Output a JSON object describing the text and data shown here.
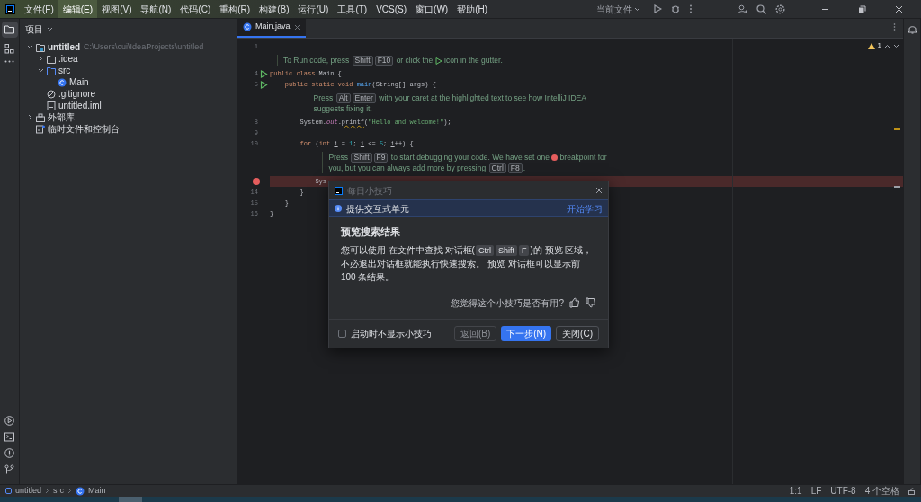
{
  "menu": [
    {
      "label": "文件(F)",
      "selected": false
    },
    {
      "label": "编辑(E)",
      "selected": true
    },
    {
      "label": "视图(V)",
      "selected": false
    },
    {
      "label": "导航(N)",
      "selected": false
    },
    {
      "label": "代码(C)",
      "selected": false
    },
    {
      "label": "重构(R)",
      "selected": false
    },
    {
      "label": "构建(B)",
      "selected": false
    },
    {
      "label": "运行(U)",
      "selected": false
    },
    {
      "label": "工具(T)",
      "selected": false
    },
    {
      "label": "VCS(S)",
      "selected": false
    },
    {
      "label": "窗口(W)",
      "selected": false
    },
    {
      "label": "帮助(H)",
      "selected": false
    }
  ],
  "run_config": "当前文件",
  "project_panel": {
    "title": "项目",
    "tree": [
      {
        "kind": "module",
        "label": "untitled",
        "path": "C:\\Users\\cui\\IdeaProjects\\untitled",
        "expanded": true,
        "children": [
          {
            "kind": "folder",
            "label": ".idea",
            "expanded": false
          },
          {
            "kind": "source",
            "label": "src",
            "expanded": true,
            "children": [
              {
                "kind": "class",
                "label": "Main"
              }
            ]
          },
          {
            "kind": "ignore",
            "label": ".gitignore"
          },
          {
            "kind": "file",
            "label": "untitled.iml"
          }
        ]
      },
      {
        "kind": "library",
        "label": "外部库",
        "expanded": false
      },
      {
        "kind": "scratch",
        "label": "临时文件和控制台"
      }
    ]
  },
  "editor": {
    "tab": {
      "label": "Main.java",
      "selected": true
    },
    "warnings": "1",
    "lines": [
      {
        "kind": "code",
        "number": "1"
      },
      {
        "kind": "hint",
        "parts": [
          {
            "kind": "text",
            "text": "To Run code, press "
          },
          {
            "kind": "key",
            "text": "Shift"
          },
          {
            "kind": "key",
            "text": "F10"
          },
          {
            "kind": "text",
            "text": " or click the "
          },
          {
            "kind": "run-icon"
          },
          {
            "kind": "text",
            "text": " icon in the gutter."
          }
        ]
      },
      {
        "kind": "code",
        "number": "4",
        "run": true,
        "tokens": [
          {
            "kind": "keyword",
            "text": "public class "
          },
          {
            "kind": "plain",
            "text": "Main {"
          }
        ]
      },
      {
        "kind": "code",
        "number": "5",
        "run": true,
        "tokens": [
          {
            "kind": "keyword",
            "text": "    public static void "
          },
          {
            "kind": "method",
            "text": "main"
          },
          {
            "kind": "plain",
            "text": "(String[] args) {"
          }
        ]
      },
      {
        "kind": "hint",
        "parts": [
          {
            "kind": "text",
            "text": "Press "
          },
          {
            "kind": "key",
            "text": "Alt"
          },
          {
            "kind": "key",
            "text": "Enter"
          },
          {
            "kind": "text",
            "text": " with your caret at the highlighted text to see how IntelliJ IDEA suggests fixing it."
          }
        ]
      },
      {
        "kind": "code",
        "number": "8",
        "tokens": [
          {
            "kind": "plain",
            "text": "        System."
          },
          {
            "kind": "field",
            "text": "out"
          },
          {
            "kind": "plain",
            "text": "."
          },
          {
            "kind": "warning",
            "text": "printf"
          },
          {
            "kind": "plain",
            "text": "("
          },
          {
            "kind": "string",
            "text": "\"Hello and welcome!\""
          },
          {
            "kind": "plain",
            "text": ");"
          }
        ]
      },
      {
        "kind": "code",
        "number": "9"
      },
      {
        "kind": "code",
        "number": "10",
        "tokens": [
          {
            "kind": "keyword",
            "text": "        for "
          },
          {
            "kind": "plain",
            "text": "("
          },
          {
            "kind": "keyword",
            "text": "int "
          },
          {
            "kind": "variable",
            "text": "i"
          },
          {
            "kind": "plain",
            "text": " = "
          },
          {
            "kind": "number",
            "text": "1"
          },
          {
            "kind": "plain",
            "text": "; "
          },
          {
            "kind": "variable",
            "text": "i"
          },
          {
            "kind": "plain",
            "text": " <= "
          },
          {
            "kind": "number",
            "text": "5"
          },
          {
            "kind": "plain",
            "text": "; "
          },
          {
            "kind": "variable",
            "text": "i"
          },
          {
            "kind": "plain",
            "text": "++) {"
          }
        ]
      },
      {
        "kind": "hint",
        "parts": [
          {
            "kind": "text",
            "text": "Press "
          },
          {
            "kind": "key",
            "text": "Shift"
          },
          {
            "kind": "key",
            "text": "F9"
          },
          {
            "kind": "text",
            "text": " to start debugging your code. We have set one "
          },
          {
            "kind": "breakpoint-icon"
          },
          {
            "kind": "text",
            "text": " breakpoint for you, but you can always add more by pressing "
          },
          {
            "kind": "key",
            "text": "Ctrl"
          },
          {
            "kind": "key",
            "text": "F8"
          },
          {
            "kind": "text",
            "text": "."
          }
        ]
      },
      {
        "kind": "code",
        "breakpoint": true,
        "tokens": [
          {
            "kind": "plain",
            "text": "            Sys"
          }
        ]
      },
      {
        "kind": "code",
        "number": "14",
        "tokens": [
          {
            "kind": "plain",
            "text": "        }"
          }
        ]
      },
      {
        "kind": "code",
        "number": "15",
        "tokens": [
          {
            "kind": "plain",
            "text": "    }"
          }
        ]
      },
      {
        "kind": "code",
        "number": "16",
        "tokens": [
          {
            "kind": "plain",
            "text": "}"
          }
        ]
      }
    ]
  },
  "tip_dialog": {
    "title": "每日小技巧",
    "banner": {
      "text": "提供交互式单元",
      "link": "开始学习"
    },
    "heading": "预览搜索结果",
    "body": [
      {
        "kind": "text",
        "text": "您可以使用 在文件中查找 对话框("
      },
      {
        "kind": "key",
        "text": "Ctrl"
      },
      {
        "kind": "key",
        "text": "Shift"
      },
      {
        "kind": "key",
        "text": "F"
      },
      {
        "kind": "text",
        "text": ")的 预览 区域，不必退出对话框就能执行快速搜索。 预览 对话框可以显示前 100 条结果。"
      }
    ],
    "feedback": "您觉得这个小技巧是否有用?",
    "checkbox": {
      "label": "启动时不显示小技巧",
      "checked": false
    },
    "buttons": [
      {
        "label": "返回(B)",
        "kind": "default",
        "disabled": true
      },
      {
        "label": "下一步(N)",
        "kind": "primary",
        "disabled": false
      },
      {
        "label": "关闭(C)",
        "kind": "default",
        "disabled": false
      }
    ]
  },
  "breadcrumbs": [
    {
      "kind": "module",
      "label": "untitled"
    },
    {
      "kind": "folder",
      "label": "src"
    },
    {
      "kind": "class",
      "label": "Main"
    }
  ],
  "status": [
    "1:1",
    "LF",
    "UTF-8",
    "4 个空格"
  ]
}
